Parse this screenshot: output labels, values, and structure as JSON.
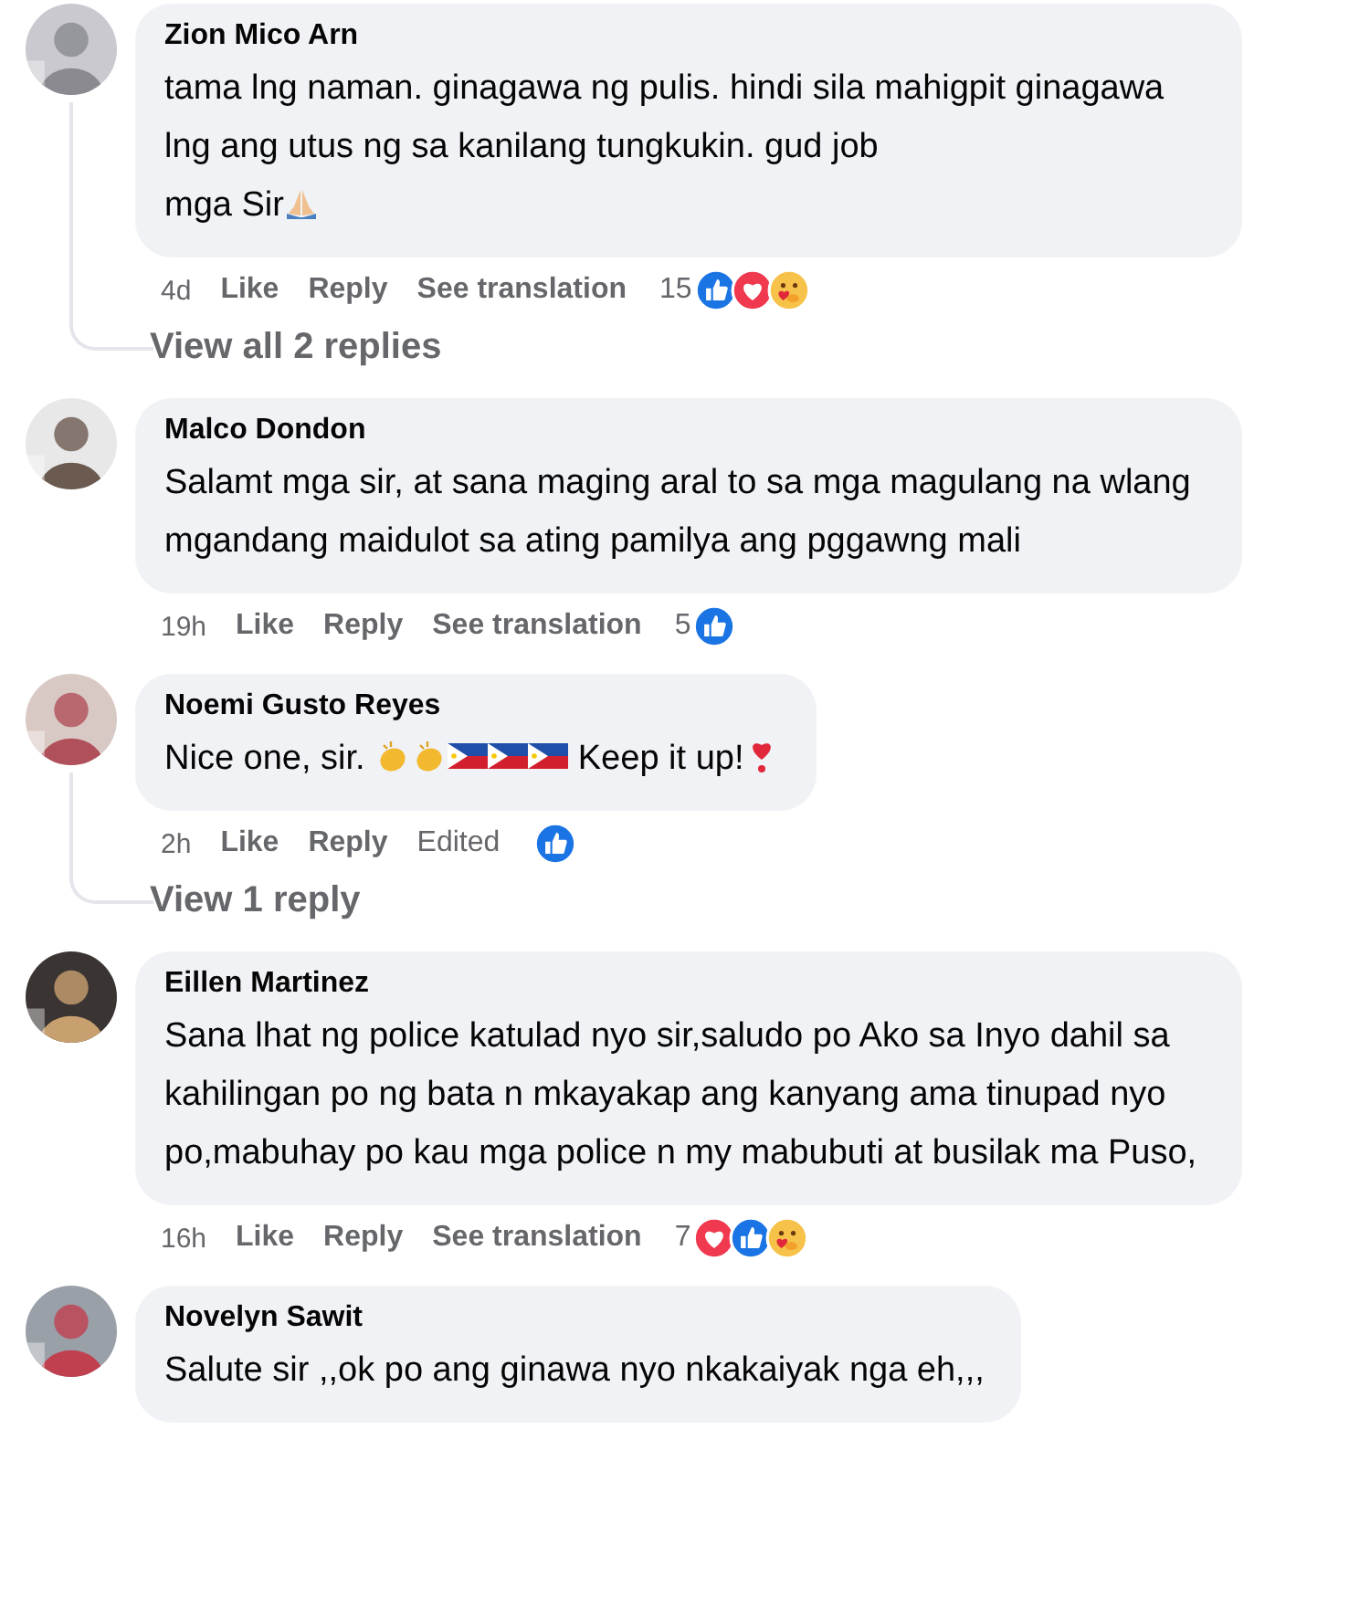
{
  "comments": [
    {
      "name": "Zion Mico Arn",
      "body": [
        {
          "kind": "text",
          "text": "tama lng naman. ginagawa ng pulis. hindi sila mahigpit ginagawa lng ang utus ng sa kanilang tungkukin. gud job"
        },
        {
          "kind": "break"
        },
        {
          "kind": "text",
          "text": "mga Sir"
        },
        {
          "kind": "pray"
        }
      ],
      "time": "4d",
      "actions": [
        {
          "kind": "link",
          "label": "Like"
        },
        {
          "kind": "link",
          "label": "Reply"
        },
        {
          "kind": "link",
          "label": "See translation"
        }
      ],
      "reaction_count": "15",
      "reactions": [
        {
          "kind": "like"
        },
        {
          "kind": "love"
        },
        {
          "kind": "care"
        }
      ],
      "replies_link": "View all 2 replies"
    },
    {
      "name": "Malco Dondon",
      "body": [
        {
          "kind": "text",
          "text": "Salamt mga sir, at sana maging aral to sa mga magulang na wlang mgandang maidulot sa ating pamilya ang pggawng mali"
        }
      ],
      "time": "19h",
      "actions": [
        {
          "kind": "link",
          "label": "Like"
        },
        {
          "kind": "link",
          "label": "Reply"
        },
        {
          "kind": "link",
          "label": "See translation"
        }
      ],
      "reaction_count": "5",
      "reactions": [
        {
          "kind": "like"
        }
      ]
    },
    {
      "name": "Noemi Gusto Reyes",
      "body": [
        {
          "kind": "text",
          "text": "Nice one, sir. "
        },
        {
          "kind": "clap"
        },
        {
          "kind": "clap"
        },
        {
          "kind": "flag"
        },
        {
          "kind": "flag"
        },
        {
          "kind": "flag"
        },
        {
          "kind": "text",
          "text": " Keep it up!"
        },
        {
          "kind": "heart"
        }
      ],
      "time": "2h",
      "actions": [
        {
          "kind": "link",
          "label": "Like"
        },
        {
          "kind": "link",
          "label": "Reply"
        },
        {
          "kind": "note",
          "label": "Edited"
        }
      ],
      "reactions": [
        {
          "kind": "like"
        }
      ],
      "replies_link": "View 1 reply"
    },
    {
      "name": "Eillen Martinez",
      "body": [
        {
          "kind": "text",
          "text": "Sana lhat ng police katulad nyo sir,saludo po Ako sa Inyo dahil sa kahilingan po ng bata n mkayakap ang kanyang ama tinupad nyo po,mabuhay po kau mga police n my mabubuti at busilak ma Puso,"
        }
      ],
      "time": "16h",
      "actions": [
        {
          "kind": "link",
          "label": "Like"
        },
        {
          "kind": "link",
          "label": "Reply"
        },
        {
          "kind": "link",
          "label": "See translation"
        }
      ],
      "reaction_count": "7",
      "reactions": [
        {
          "kind": "love"
        },
        {
          "kind": "like"
        },
        {
          "kind": "care"
        }
      ]
    },
    {
      "name": "Novelyn Sawit",
      "body": [
        {
          "kind": "text",
          "text": "Salute sir ,,ok po ang ginawa nyo nkakaiyak nga eh,,,"
        }
      ]
    }
  ]
}
